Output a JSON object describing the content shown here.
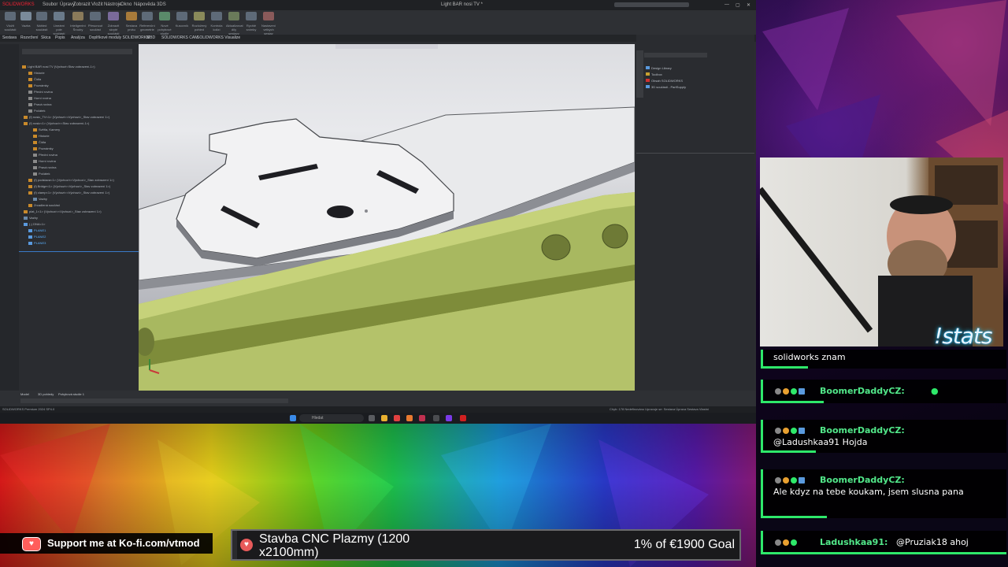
{
  "solidworks": {
    "title_left": "SOLIDWORKS",
    "doc_title": "Light BAR nosi TV *",
    "menu": [
      "Soubor",
      "Úpravy",
      "Zobrazit",
      "Vložit",
      "Nástroje",
      "Okno",
      "Nápověda 3DS"
    ],
    "ribbon": [
      "Vložit součásti",
      "Vazba",
      "Náhled součásti",
      "Lineární pole součástí",
      "Inteligentní Šrouby",
      "Přesunout součást",
      "Zobrazit skryté součásti",
      "Sestava prvku",
      "Referenční geometrie",
      "Nové pohybové studie",
      "Kusovník",
      "Rozložený pohled",
      "Kontrola kolizí",
      "Aktualizovat díly sestavy SpeedPak",
      "Rychlé snímky",
      "Nastavení velkých sestav"
    ],
    "tabs": [
      "Sestava",
      "Rozvržení",
      "Skica",
      "Popis",
      "Analýza",
      "Doplňkové moduly SOLIDWORKS",
      "MBD",
      "SOLIDWORKS CAM",
      "SOLIDWORKS Visualize"
    ],
    "tree": [
      "Light BAR nosi TV (Výchozí<Stav zobrazení-1>)",
      "Historie",
      "Čidla",
      "Poznámky",
      "Přední rovina",
      "Horní rovina",
      "Pravá rovina",
      "Počátek",
      "(f) nosic_TV<1> (Výchozí<<Výchozí>_Stav zobrazení 1>)",
      "(f) nosic<1> (Výchozí<<Stav zobrazení-1>)",
      "Světla, Kamery",
      "Historie",
      "Čidla",
      "Poznámky",
      "Přední rovina",
      "Horní rovina",
      "Pravá rovina",
      "Počátek",
      "(f) podstava<1> (Výchozí<<Výchozí>_Stav zobrazení 1>)",
      "(f) Bridge<1> (Výchozí<<Výchozí>_Stav zobrazení 1>)",
      "(f) clamp<1> (Výchozí<<Výchozí>_Stav zobrazení 1>)",
      "Vazby",
      "Zrcadlená součást",
      "plat_1<1> (Výchozí<<Výchozí>_Stav zobrazení 1>)",
      "Vazby",
      "(-) DNA<1>",
      "PLANE1",
      "PLANE2",
      "PLANE3"
    ],
    "right_pane": [
      "Design Library",
      "Toolbox",
      "Obsah SOLIDWORKS",
      "3D součásti - PartSupply"
    ],
    "bottom_tabs": [
      "Model",
      "3D pohledy",
      "Pohybová studie 1"
    ],
    "status_left": "SOLIDWORKS Premium 2024 SP4.0",
    "status_right": "Chyb: 178   Nedefinováno   Upravuje se: Sestava   Úprava Sestava   Vlastní",
    "taskbar_search": "Hledat"
  },
  "overlay": {
    "stats_command": "!stats",
    "kofi_text": "Support me at Ko-fi.com/vtmod",
    "goal_title": "Stavba CNC Plazmy (1200 x2100mm)",
    "goal_amount": "1% of €1900 Goal",
    "goal_progress": 0.01
  },
  "chat": [
    {
      "name": "",
      "text": "solidworks znam"
    },
    {
      "name": "BoomerDaddyCZ:",
      "text": ""
    },
    {
      "name": "BoomerDaddyCZ:",
      "text": "@Ladushkaa91 Hojda"
    },
    {
      "name": "BoomerDaddyCZ:",
      "text": "Ale kdyz na tebe koukam, jsem slusna pana"
    },
    {
      "name": "Ladushkaa91:",
      "text": "@Pruziak18 ahoj"
    }
  ],
  "colors": {
    "chat_accent": "#2ee86a",
    "name_color": "#52e88a",
    "stats_glow": "#2ad4ff",
    "part_green": "#a8b860"
  }
}
